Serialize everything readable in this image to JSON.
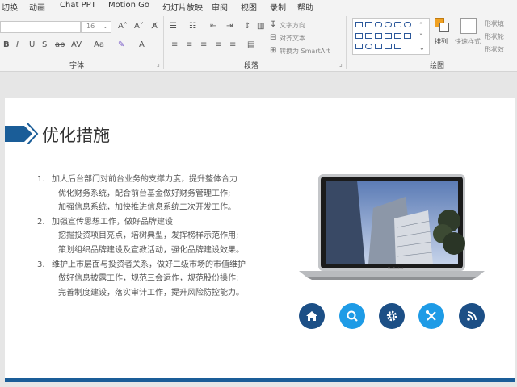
{
  "ribbon_tabs": [
    "切换",
    "动画",
    "Chat PPT",
    "Motion Go",
    "幻灯片放映",
    "审阅",
    "视图",
    "录制",
    "帮助"
  ],
  "font": {
    "size": "16",
    "group_label": "字体"
  },
  "paragraph": {
    "text_direction": "文字方向",
    "align_text": "对齐文本",
    "convert_smartart": "转换为 SmartArt",
    "group_label": "段落"
  },
  "drawing": {
    "arrange": "排列",
    "quick_styles": "快速样式",
    "shape_fill": "形状填",
    "shape_outline": "形状轮",
    "shape_effects": "形状效",
    "group_label": "绘图"
  },
  "slide": {
    "title": "优化措施",
    "items": [
      {
        "num": "1.",
        "lines": [
          "加大后台部门对前台业务的支撑力度，提升整体合力",
          "优化财务系统，配合前台基金做好财务管理工作;",
          "加强信息系统，加快推进信息系统二次开发工作。"
        ]
      },
      {
        "num": "2.",
        "lines": [
          "加强宣传思想工作，做好品牌建设",
          "挖掘投资项目亮点，培树典型，发挥榜样示范作用;",
          "策划组织品牌建设及宣教活动，强化品牌建设效果。"
        ]
      },
      {
        "num": "3.",
        "lines": [
          "维护上市层面与投资者关系，做好二级市场的市值维护",
          "做好信息披露工作，规范三会运作，规范股份操作;",
          "完善制度建设，落实审计工作，提升风险防控能力。"
        ]
      }
    ],
    "laptop_label": "MacBook Air"
  },
  "colors": {
    "accent": "#1a5d98",
    "circle_dark": "#1c4f86",
    "circle_light": "#1e9be6"
  },
  "icons": [
    "home-icon",
    "search-icon",
    "gear-icon",
    "tools-icon",
    "rss-icon"
  ]
}
